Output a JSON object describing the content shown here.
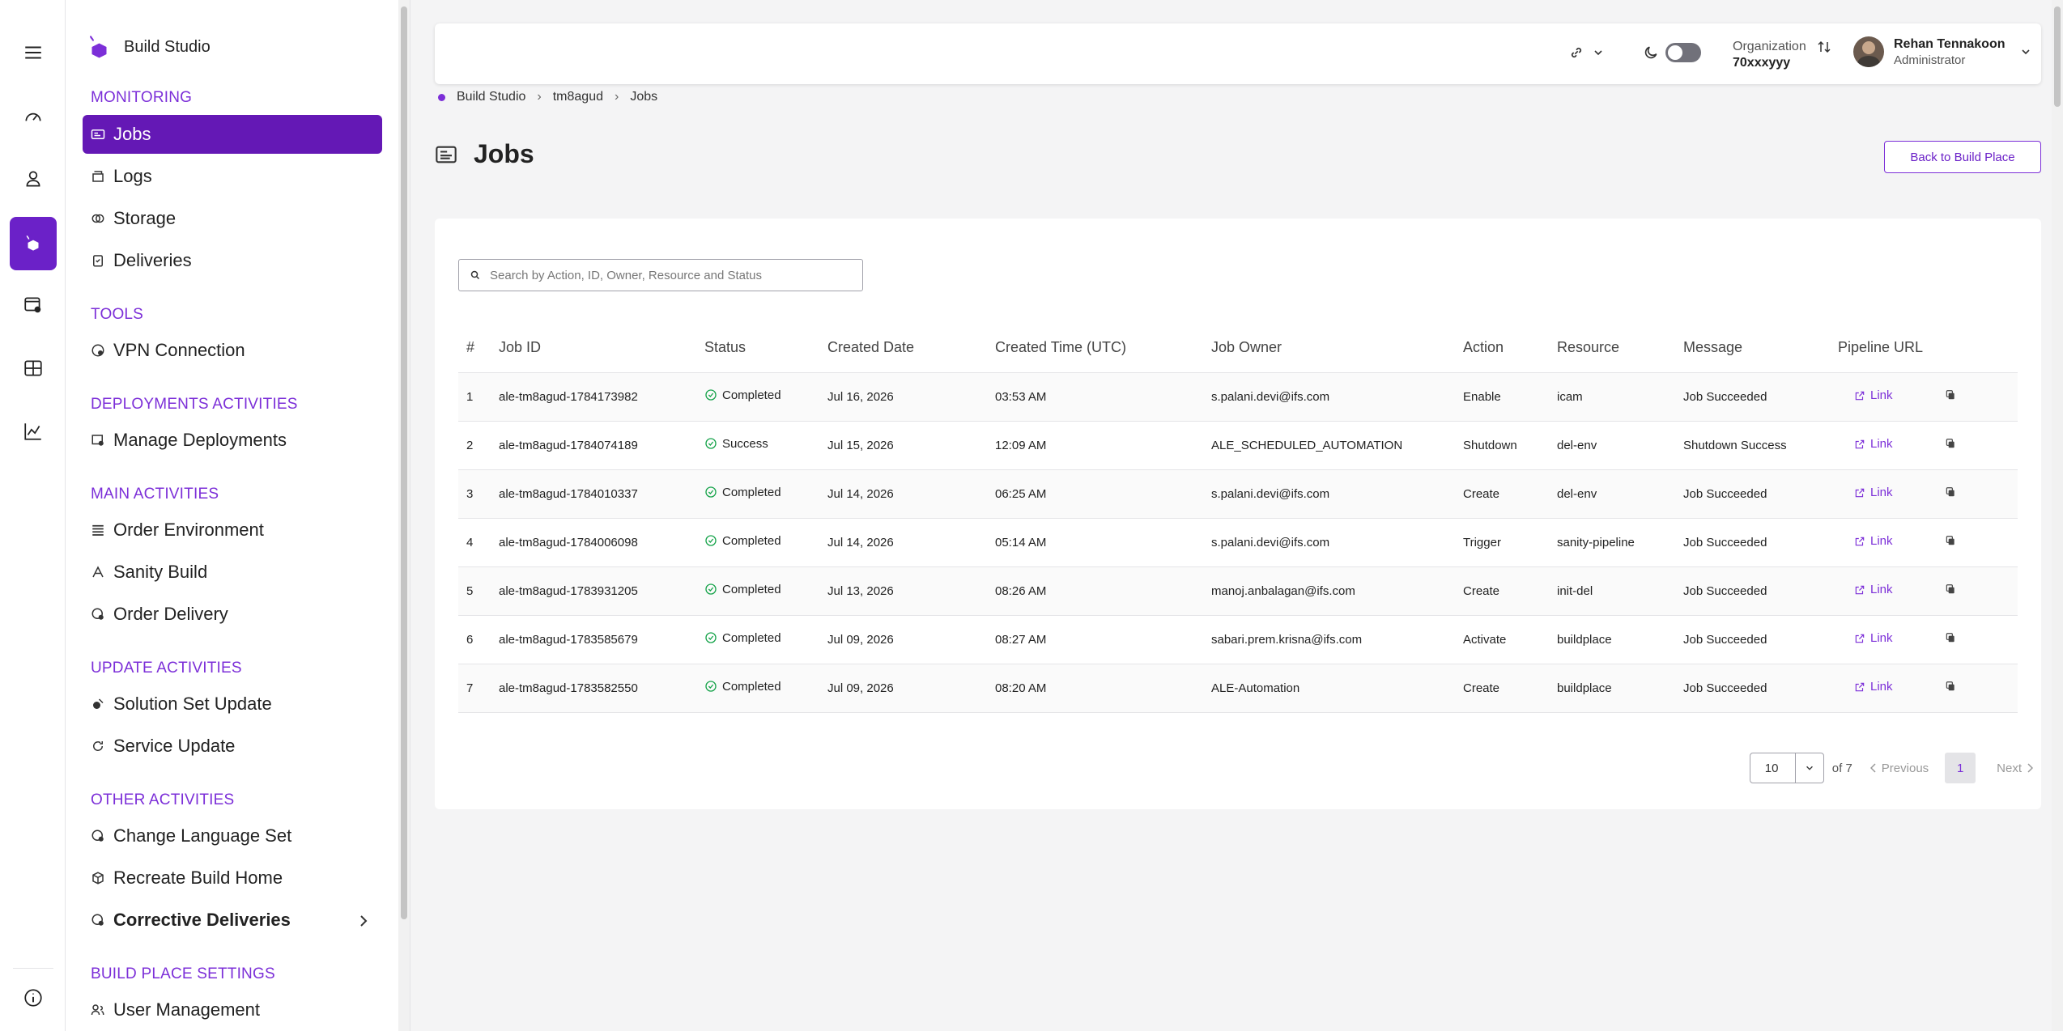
{
  "brand": {
    "name": "Build Studio"
  },
  "sidebar": {
    "sections": [
      {
        "heading": "MONITORING",
        "items": [
          {
            "label": "Jobs",
            "icon": "jobs-icon",
            "active": true
          },
          {
            "label": "Logs",
            "icon": "logs-icon"
          },
          {
            "label": "Storage",
            "icon": "storage-icon"
          },
          {
            "label": "Deliveries",
            "icon": "deliveries-icon"
          }
        ]
      },
      {
        "heading": "TOOLS",
        "items": [
          {
            "label": "VPN Connection",
            "icon": "vpn-icon"
          }
        ]
      },
      {
        "heading": "DEPLOYMENTS ACTIVITIES",
        "items": [
          {
            "label": "Manage Deployments",
            "icon": "deployments-icon"
          }
        ]
      },
      {
        "heading": "MAIN ACTIVITIES",
        "items": [
          {
            "label": "Order Environment",
            "icon": "environment-icon"
          },
          {
            "label": "Sanity Build",
            "icon": "sanity-icon"
          },
          {
            "label": "Order Delivery",
            "icon": "delivery-icon"
          }
        ]
      },
      {
        "heading": "UPDATE ACTIVITIES",
        "items": [
          {
            "label": "Solution Set Update",
            "icon": "solution-icon"
          },
          {
            "label": "Service Update",
            "icon": "refresh-icon"
          }
        ]
      },
      {
        "heading": "OTHER ACTIVITIES",
        "items": [
          {
            "label": "Change Language Set",
            "icon": "language-icon"
          },
          {
            "label": "Recreate Build Home",
            "icon": "cube-icon"
          },
          {
            "label": "Corrective Deliveries",
            "icon": "corrective-icon",
            "bold": true,
            "expandable": true
          }
        ]
      },
      {
        "heading": "BUILD PLACE SETTINGS",
        "items": [
          {
            "label": "User Management",
            "icon": "users-icon"
          }
        ]
      }
    ]
  },
  "topbar": {
    "org_label": "Organization",
    "org_value": "70xxxyyy",
    "user_name": "Rehan Tennakoon",
    "user_role": "Administrator"
  },
  "breadcrumb": [
    "Build Studio",
    "tm8agud",
    "Jobs"
  ],
  "page": {
    "title": "Jobs",
    "back_button": "Back to Build Place"
  },
  "search": {
    "placeholder": "Search by Action, ID, Owner, Resource and Status"
  },
  "table": {
    "headers": [
      "#",
      "Job ID",
      "Status",
      "Created Date",
      "Created Time (UTC)",
      "Job Owner",
      "Action",
      "Resource",
      "Message",
      "Pipeline URL",
      ""
    ],
    "link_label": "Link",
    "rows": [
      [
        "1",
        "ale-tm8agud-1784173982",
        "Completed",
        "Jul 16, 2026",
        "03:53 AM",
        "s.palani.devi@ifs.com",
        "Enable",
        "icam",
        "Job Succeeded"
      ],
      [
        "2",
        "ale-tm8agud-1784074189",
        "Success",
        "Jul 15, 2026",
        "12:09 AM",
        "ALE_SCHEDULED_AUTOMATION",
        "Shutdown",
        "del-env",
        "Shutdown Success"
      ],
      [
        "3",
        "ale-tm8agud-1784010337",
        "Completed",
        "Jul 14, 2026",
        "06:25 AM",
        "s.palani.devi@ifs.com",
        "Create",
        "del-env",
        "Job Succeeded"
      ],
      [
        "4",
        "ale-tm8agud-1784006098",
        "Completed",
        "Jul 14, 2026",
        "05:14 AM",
        "s.palani.devi@ifs.com",
        "Trigger",
        "sanity-pipeline",
        "Job Succeeded"
      ],
      [
        "5",
        "ale-tm8agud-1783931205",
        "Completed",
        "Jul 13, 2026",
        "08:26 AM",
        "manoj.anbalagan@ifs.com",
        "Create",
        "init-del",
        "Job Succeeded"
      ],
      [
        "6",
        "ale-tm8agud-1783585679",
        "Completed",
        "Jul 09, 2026",
        "08:27 AM",
        "sabari.prem.krisna@ifs.com",
        "Activate",
        "buildplace",
        "Job Succeeded"
      ],
      [
        "7",
        "ale-tm8agud-1783582550",
        "Completed",
        "Jul 09, 2026",
        "08:20 AM",
        "ALE-Automation",
        "Create",
        "buildplace",
        "Job Succeeded"
      ]
    ]
  },
  "pagination": {
    "page_size": "10",
    "of_text": "of 7",
    "previous": "Previous",
    "current": "1",
    "next": "Next"
  },
  "colors": {
    "accent": "#7c2fd8",
    "active_bg": "#6418b5",
    "success": "#16a34a"
  }
}
